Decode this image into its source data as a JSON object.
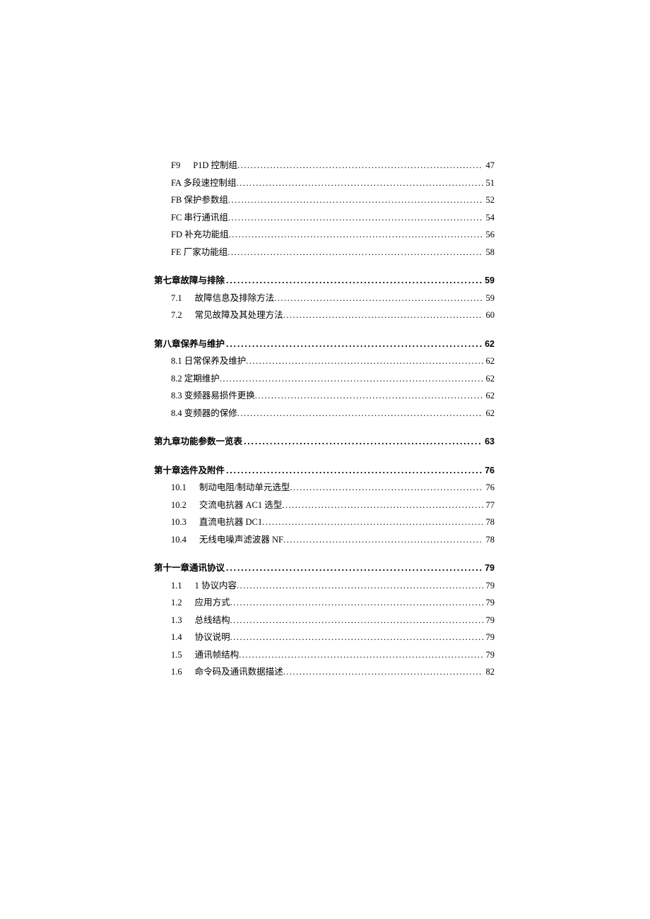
{
  "toc": [
    {
      "kind": "sub",
      "num": "F9",
      "title_prefix": "P1D ",
      "title": "控制组",
      "page": "47",
      "indent": true,
      "wide": true
    },
    {
      "kind": "sub",
      "num": "",
      "title_prefix": "FA ",
      "title": "多段速控制组",
      "page": "51",
      "indent": true
    },
    {
      "kind": "sub",
      "num": "",
      "title_prefix": "FB ",
      "title": "保护参数组",
      "page": "52",
      "indent": true
    },
    {
      "kind": "sub",
      "num": "",
      "title_prefix": "FC ",
      "title": "串行通讯组",
      "page": "54",
      "indent": true
    },
    {
      "kind": "sub",
      "num": "",
      "title_prefix": "FD ",
      "title": "补充功能组",
      "page": "56",
      "indent": true
    },
    {
      "kind": "sub",
      "num": "",
      "title_prefix": "FE ",
      "title": "厂家功能组",
      "page": "58",
      "indent": true
    },
    {
      "kind": "chapter",
      "title": "第七章故障与排除",
      "page": "59",
      "gap": true
    },
    {
      "kind": "sub",
      "num": "7.1",
      "title": "故障信息及排除方法",
      "page": "59",
      "indent": true,
      "wide": true,
      "first_after": true
    },
    {
      "kind": "sub",
      "num": "7.2",
      "title": "常见故障及其处理方法",
      "page": "60",
      "indent": true,
      "wide": true
    },
    {
      "kind": "chapter",
      "title": "第八章保养与维护",
      "page": "62",
      "gap": true
    },
    {
      "kind": "sub",
      "num": "",
      "title_prefix": "8.1 ",
      "title": "日常保养及维护",
      "page": "62",
      "indent": true,
      "first_after": true
    },
    {
      "kind": "sub",
      "num": "",
      "title_prefix": "8.2 ",
      "title": "定期维护",
      "page": "62",
      "indent": true
    },
    {
      "kind": "sub",
      "num": "",
      "title_prefix": "8.3 ",
      "title": "变频器易损件更换",
      "page": "62",
      "indent": true
    },
    {
      "kind": "sub",
      "num": "",
      "title_prefix": "8.4 ",
      "title": "变频器的保修",
      "page": "62",
      "indent": true
    },
    {
      "kind": "chapter",
      "title": "第九章功能参数一览表",
      "page": "63",
      "gap": true
    },
    {
      "kind": "chapter",
      "title": "第十章选件及附件",
      "page": "76",
      "gap": true
    },
    {
      "kind": "sub",
      "num": "10.1",
      "title": "制动电阻/制动单元选型",
      "page": "76",
      "indent": true,
      "wide": true,
      "first_after": true
    },
    {
      "kind": "sub",
      "num": "10.2",
      "title_prefix": "交流电抗器 AC1 ",
      "title": "选型",
      "page": "77",
      "indent": true,
      "wide": true
    },
    {
      "kind": "sub",
      "num": "10.3",
      "title_prefix": "直流电抗器 ",
      "title": "DC1",
      "page": "78",
      "indent": true,
      "wide": true
    },
    {
      "kind": "sub",
      "num": "10.4",
      "title_prefix": "无线电噪声滤波器 ",
      "title": "NF",
      "page": "78",
      "indent": true,
      "wide": true
    },
    {
      "kind": "chapter",
      "title": "第十一章通讯协议",
      "page": "79",
      "gap": true
    },
    {
      "kind": "sub",
      "num": "1.1",
      "title_prefix": "1 ",
      "title": "协议内容",
      "page": "79",
      "indent": true,
      "wide": true,
      "first_after": true
    },
    {
      "kind": "sub",
      "num": "1.2",
      "title": "应用方式",
      "page": "79",
      "indent": true,
      "wide": true
    },
    {
      "kind": "sub",
      "num": "1.3",
      "title": "总线结构",
      "page": "79",
      "indent": true,
      "wide": true
    },
    {
      "kind": "sub",
      "num": "1.4",
      "title": "协议说明",
      "page": "79",
      "indent": true,
      "wide": true
    },
    {
      "kind": "sub",
      "num": "1.5",
      "title": "通讯帧结构",
      "page": "79",
      "indent": true,
      "wide": true
    },
    {
      "kind": "sub",
      "num": "1.6",
      "title": "命令码及通讯数据描述",
      "page": "82",
      "indent": true,
      "wide": true
    }
  ]
}
